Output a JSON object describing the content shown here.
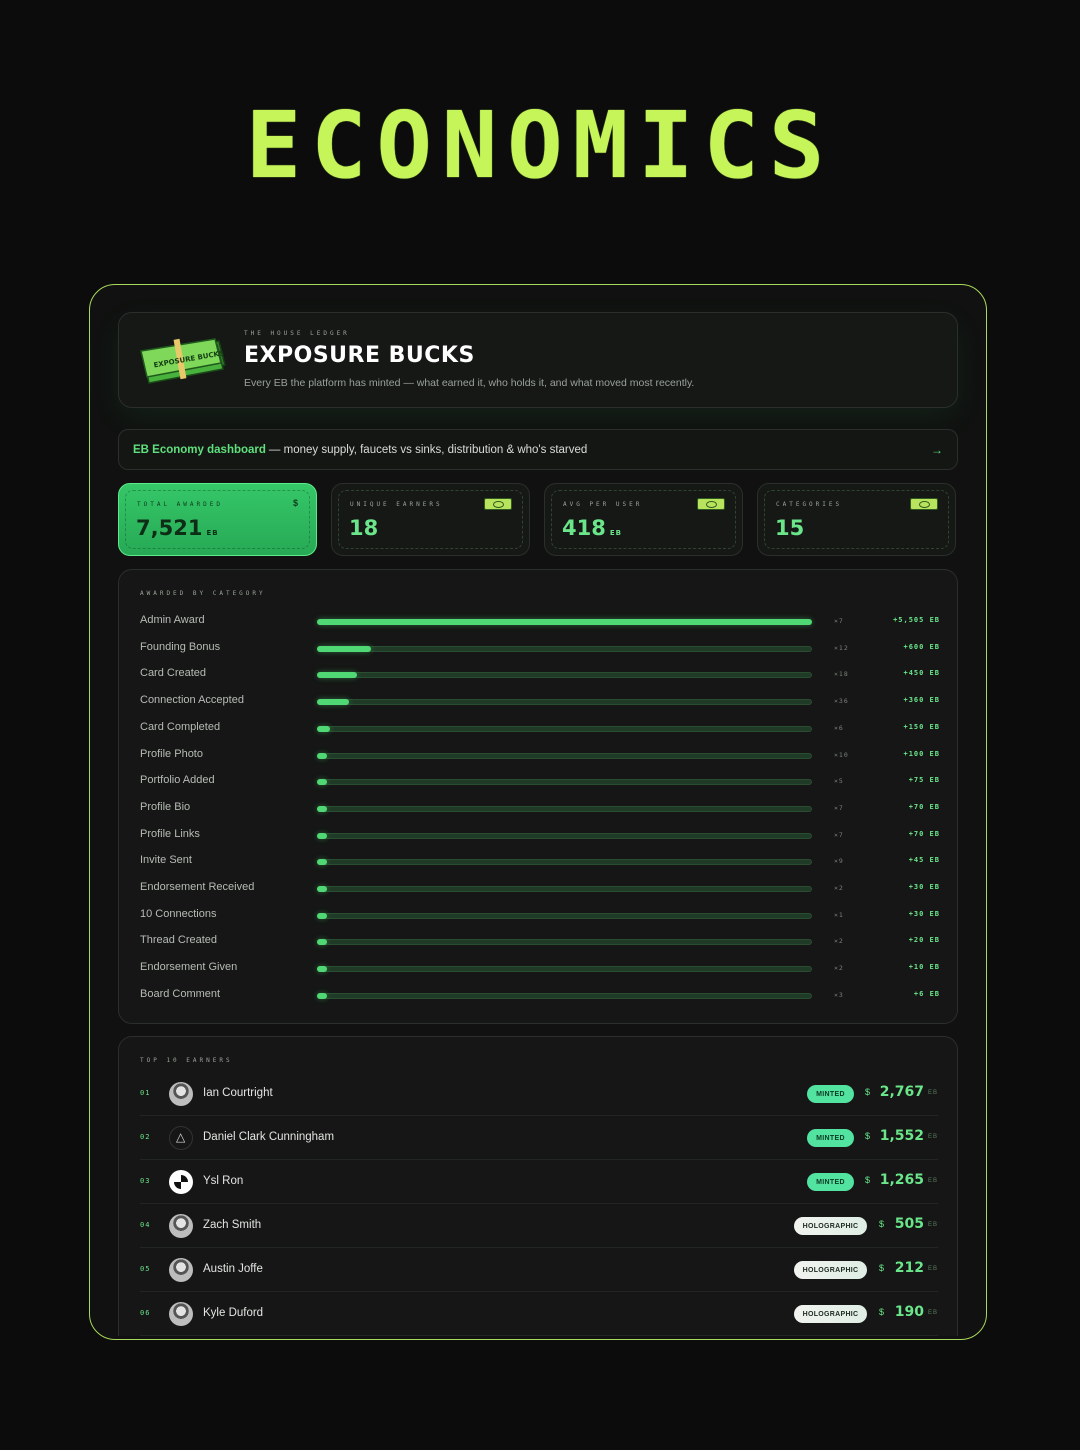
{
  "hero_title": "ECONOMICS",
  "header": {
    "eyebrow": "THE HOUSE LEDGER",
    "title": "EXPOSURE BUCKS",
    "subtitle": "Every EB the platform has minted — what earned it, who holds it, and what moved most recently.",
    "icon": "money-stack-icon",
    "icon_label": "EXPOSURE BUCKS"
  },
  "link_bar": {
    "strong": "EB Economy dashboard",
    "rest": "— money supply, faucets vs sinks, distribution & who's starved",
    "arrow": "→"
  },
  "stats": [
    {
      "label": "TOTAL AWARDED",
      "value": "7,521",
      "unit": "EB",
      "icon": "dollar-icon",
      "icon_text": "$"
    },
    {
      "label": "UNIQUE EARNERS",
      "value": "18",
      "unit": "",
      "icon": "banknote-icon"
    },
    {
      "label": "AVG PER USER",
      "value": "418",
      "unit": "EB",
      "icon": "banknote-icon"
    },
    {
      "label": "CATEGORIES",
      "value": "15",
      "unit": "",
      "icon": "banknote-icon"
    }
  ],
  "categories_label": "AWARDED BY CATEGORY",
  "chart_data": {
    "type": "bar",
    "orientation": "horizontal",
    "title": "AWARDED BY CATEGORY",
    "categories": [
      "Admin Award",
      "Founding Bonus",
      "Card Created",
      "Connection Accepted",
      "Card Completed",
      "Profile Photo",
      "Portfolio Added",
      "Profile Bio",
      "Profile Links",
      "Invite Sent",
      "Endorsement Received",
      "10 Connections",
      "Thread Created",
      "Endorsement Given",
      "Board Comment"
    ],
    "counts": [
      "×7",
      "×12",
      "×18",
      "×36",
      "×6",
      "×10",
      "×5",
      "×7",
      "×7",
      "×9",
      "×2",
      "×1",
      "×2",
      "×2",
      "×3"
    ],
    "amount_labels": [
      "+5,505 EB",
      "+600 EB",
      "+450 EB",
      "+360 EB",
      "+150 EB",
      "+100 EB",
      "+75 EB",
      "+70 EB",
      "+70 EB",
      "+45 EB",
      "+30 EB",
      "+30 EB",
      "+20 EB",
      "+10 EB",
      "+6 EB"
    ],
    "values": [
      5505,
      600,
      450,
      360,
      150,
      100,
      75,
      70,
      70,
      45,
      30,
      30,
      20,
      10,
      6
    ],
    "xlim": [
      0,
      5505
    ],
    "colors": {
      "fill": "#4fd874",
      "track": "#1f3a26"
    }
  },
  "earners_label": "TOP 10 EARNERS",
  "earners": [
    {
      "rank": "01",
      "name": "Ian Courtright",
      "badge": "MINTED",
      "badge_type": "minted",
      "amount": "2,767",
      "unit": "EB",
      "dollar": "$"
    },
    {
      "rank": "02",
      "name": "Daniel Clark Cunningham",
      "badge": "MINTED",
      "badge_type": "minted",
      "amount": "1,552",
      "unit": "EB",
      "dollar": "$"
    },
    {
      "rank": "03",
      "name": "Ysl Ron",
      "badge": "MINTED",
      "badge_type": "minted",
      "amount": "1,265",
      "unit": "EB",
      "dollar": "$"
    },
    {
      "rank": "04",
      "name": "Zach Smith",
      "badge": "HOLOGRAPHIC",
      "badge_type": "holo",
      "amount": "505",
      "unit": "EB",
      "dollar": "$"
    },
    {
      "rank": "05",
      "name": "Austin Joffe",
      "badge": "HOLOGRAPHIC",
      "badge_type": "holo",
      "amount": "212",
      "unit": "EB",
      "dollar": "$"
    },
    {
      "rank": "06",
      "name": "Kyle Duford",
      "badge": "HOLOGRAPHIC",
      "badge_type": "holo",
      "amount": "190",
      "unit": "EB",
      "dollar": "$"
    }
  ],
  "colors": {
    "accent": "#c6f55a",
    "green": "#6ae58a",
    "background": "#0b0c0b"
  }
}
